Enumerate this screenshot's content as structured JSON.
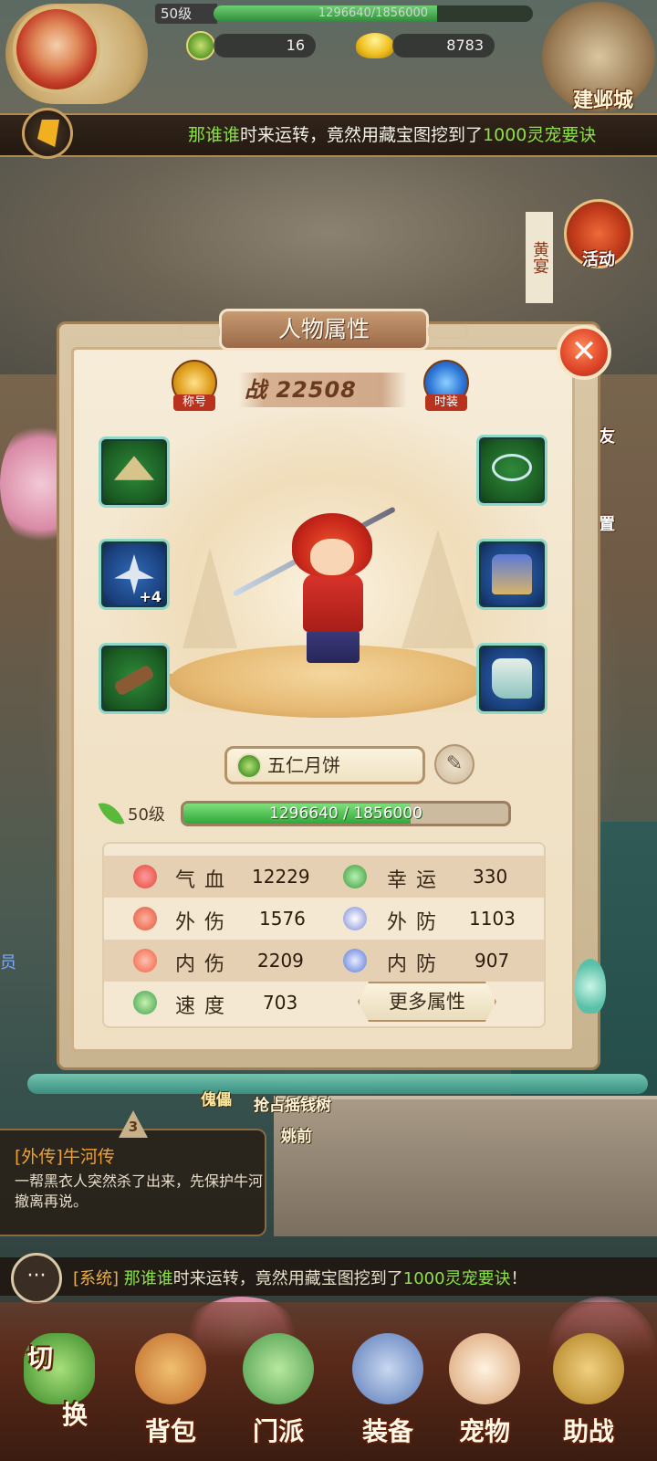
{
  "hud": {
    "level": "50级",
    "xp_text": "1296640/1856000",
    "xp_fraction": 0.6986,
    "jade": "16",
    "ingot": "8783",
    "city_label": "建邺城"
  },
  "marquee": {
    "name": "那谁谁",
    "mid": "时来运转，竟然用藏宝图挖到了",
    "item": "1000灵宠要诀"
  },
  "side_buttons": {
    "activity": "活动",
    "friends": "好友",
    "settings": "设置",
    "vertical_sign": "黄宴"
  },
  "panel": {
    "title": "人物属性",
    "close": "✕",
    "title_badge": "称号",
    "fashion_badge": "时装",
    "power_prefix": "战",
    "power_value": "22508",
    "weapon_plus": "+4",
    "character_name": "五仁月饼",
    "edit_icon": "✎",
    "level": "50级",
    "xp_text": "1296640 / 1856000",
    "xp_fraction": 0.6986,
    "more_button": "更多属性",
    "stats": [
      {
        "name": "气血",
        "value": "12229"
      },
      {
        "name": "幸运",
        "value": "330"
      },
      {
        "name": "外伤",
        "value": "1576"
      },
      {
        "name": "外防",
        "value": "1103"
      },
      {
        "name": "内伤",
        "value": "2209"
      },
      {
        "name": "内防",
        "value": "907"
      },
      {
        "name": "速度",
        "value": "703"
      }
    ]
  },
  "scene": {
    "npc1": "傀儡",
    "npc2": "抢占摇钱树",
    "npc3": "姚前",
    "left_edge": "员"
  },
  "quest": {
    "step": "3",
    "title": "[外传]牛河传",
    "desc": "一帮黑衣人突然杀了出来，先保护牛河撤离再说。"
  },
  "chat": {
    "tag": "[系统]",
    "name": "那谁谁",
    "mid": "时来运转，竟然用藏宝图挖到了",
    "item": "1000灵宠要诀",
    "end": "！",
    "icon": "···"
  },
  "menu": {
    "switch_top": "切",
    "switch_bottom": "换",
    "bag": "背包",
    "sect": "门派",
    "equip": "装备",
    "pet": "宠物",
    "assist": "助战"
  },
  "colors": {
    "highlight": "#8ce04a",
    "xp_green": "#2fa83a",
    "close_red": "#e0482a"
  }
}
